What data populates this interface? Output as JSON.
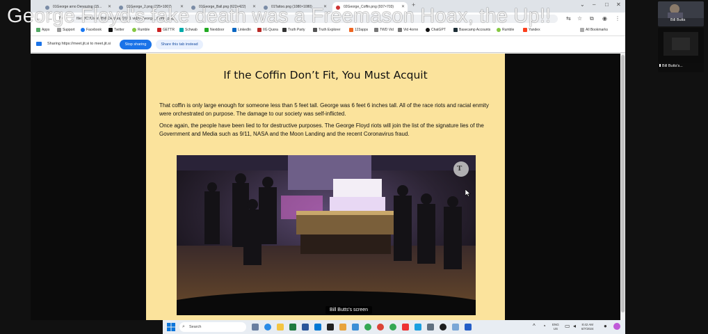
{
  "overlay_caption": "George Floyd's fake death was a Freemason Hoax, the Up!!",
  "browser": {
    "tabs": [
      {
        "label": "01George arno Dereszing (15..."
      },
      {
        "label": "01George_2.png (725×1007)"
      },
      {
        "label": "01George_Ball.png (622×422)"
      },
      {
        "label": "01Tattoo.png (1080×1080)"
      },
      {
        "label": "02George_Coffin.png (937×703)"
      }
    ],
    "address": "file:///C:/Users/Bill/Desktop/2021 vid/0 George_Coffin.png",
    "bookmarks": [
      "Apps",
      "Support",
      "Facebook",
      "Twitter",
      "Rumble",
      "GETTR",
      "Schwab",
      "Nextdoor",
      "LinkedIn",
      "IIG Quora",
      "Truth Party",
      "Truth Explorer",
      "123apps",
      "TWD Vid",
      "Vid 4ornn",
      "ChatGPT",
      "Basecamp Accounts",
      "Rumble",
      "Yandex",
      "All Bookmarks"
    ],
    "sharing_text": "Sharing https://meet.jit.si to meet.jit.si",
    "stop_sharing": "Stop sharing",
    "share_instead": "Share this tab instead"
  },
  "slide": {
    "title": "If the Coffin Don’t Fit, You Must Acquit",
    "paragraph1": "That coffin is only large enough for someone less than 5 feet tall.  George was 6 feet 6 inches tall.  All of the race riots and racial enmity were orchestrated on purpose.  The damage to our society was self-inflicted.",
    "paragraph2": "Once again, the people have been lied to for destructive purposes.  The George Floyd riots will join the list of the signature lies of the Government and Media such as 9/11, NASA and the Moon Landing and the recent Coronavirus fraud.",
    "image_watermark": "T"
  },
  "presenter_label": "Bill Butts's screen",
  "taskbar": {
    "search_placeholder": "Search",
    "language": "ENG",
    "region": "US",
    "time": "8:42 AM",
    "date": "8/7/2024"
  },
  "participants": [
    {
      "name": "Bill Butts"
    },
    {
      "name": "Bill Butts's..."
    }
  ],
  "colors": {
    "slide_bg": "#fbe39c",
    "stop_button": "#1a73e8",
    "share_instead_bg": "#e8f0fe"
  }
}
